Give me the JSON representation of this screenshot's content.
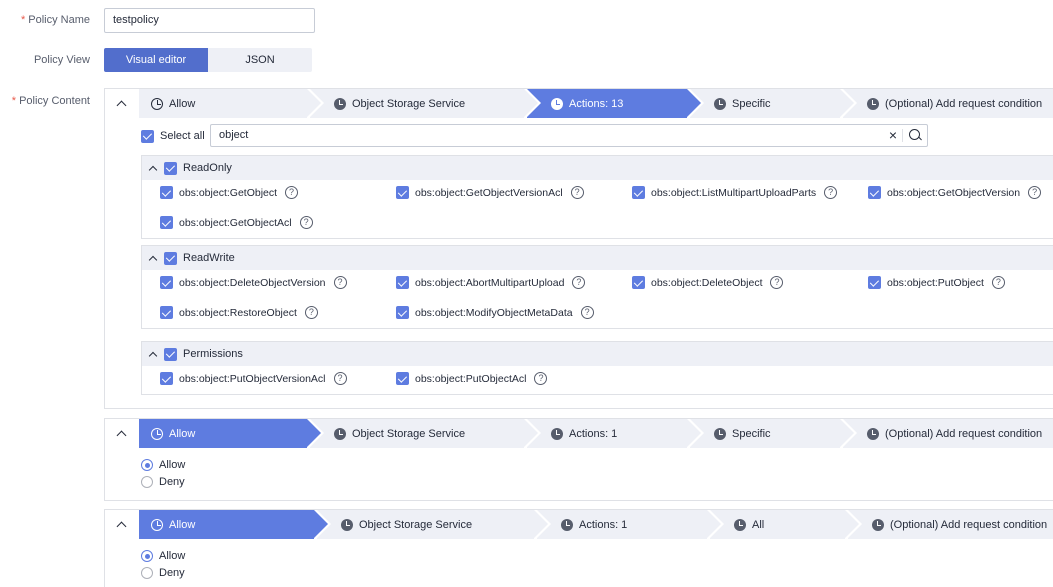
{
  "form": {
    "policy_name_label": "Policy Name",
    "policy_name_value": "testpolicy",
    "policy_view_label": "Policy View",
    "policy_content_label": "Policy Content",
    "required_mark": "*"
  },
  "view_toggle": {
    "visual_label": "Visual editor",
    "json_label": "JSON",
    "selected": "Visual editor"
  },
  "statement1": {
    "steps": [
      "Allow",
      "Object Storage Service",
      "Actions: 13",
      "Specific",
      "(Optional) Add request condition"
    ],
    "active_step": 2,
    "select_all_label": "Select all",
    "search_value": "object",
    "groups": [
      {
        "name": "ReadOnly",
        "actions": [
          "obs:object:GetObject",
          "obs:object:GetObjectVersionAcl",
          "obs:object:ListMultipartUploadParts",
          "obs:object:GetObjectVersion",
          "obs:object:GetObjectAcl"
        ]
      },
      {
        "name": "ReadWrite",
        "actions": [
          "obs:object:DeleteObjectVersion",
          "obs:object:AbortMultipartUpload",
          "obs:object:DeleteObject",
          "obs:object:PutObject",
          "obs:object:RestoreObject",
          "obs:object:ModifyObjectMetaData"
        ]
      },
      {
        "name": "Permissions",
        "actions": [
          "obs:object:PutObjectVersionAcl",
          "obs:object:PutObjectAcl"
        ]
      }
    ]
  },
  "statement2": {
    "steps": [
      "Allow",
      "Object Storage Service",
      "Actions: 1",
      "Specific",
      "(Optional) Add request condition"
    ],
    "active_step": 0,
    "options": [
      "Allow",
      "Deny"
    ],
    "selected": "Allow"
  },
  "statement3": {
    "steps": [
      "Allow",
      "Object Storage Service",
      "Actions: 1",
      "All",
      "(Optional) Add request condition"
    ],
    "active_step": 0,
    "options": [
      "Allow",
      "Deny"
    ],
    "selected": "Allow"
  },
  "colors": {
    "accent": "#5e7ce0",
    "toggle_active": "#526ecc",
    "required": "#e8594a"
  },
  "icons": {
    "step_current": "clock-outline-icon",
    "step_pending": "clock-filled-icon",
    "collapse": "chevron-up-icon",
    "help": "help-circle-icon",
    "search": "search-icon",
    "clear": "close-icon"
  }
}
